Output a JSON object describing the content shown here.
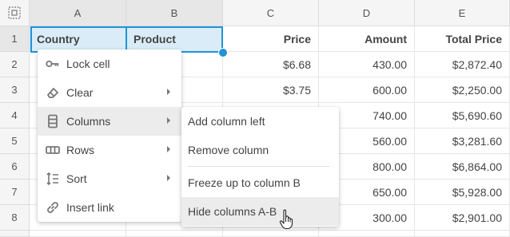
{
  "sheet": {
    "columns": [
      "A",
      "B",
      "C",
      "D",
      "E"
    ],
    "rows": [
      "1",
      "2",
      "3",
      "4",
      "5",
      "6",
      "7",
      "8"
    ],
    "header_row": [
      "Country",
      "Product",
      "Price",
      "Amount",
      "Total Price"
    ],
    "data": [
      [
        "",
        "",
        "$6.68",
        "430.00",
        "$2,872.40"
      ],
      [
        "",
        "",
        "$3.75",
        "600.00",
        "$2,250.00"
      ],
      [
        "",
        "",
        "",
        "740.00",
        "$5,690.60"
      ],
      [
        "",
        "",
        "",
        "560.00",
        "$3,281.60"
      ],
      [
        "",
        "",
        "",
        "800.00",
        "$6,864.00"
      ],
      [
        "",
        "",
        "",
        "650.00",
        "$5,928.00"
      ],
      [
        "",
        "",
        "",
        "300.00",
        "$2,901.00"
      ]
    ]
  },
  "context_menu": {
    "items": [
      {
        "label": "Lock cell",
        "icon": "key-icon"
      },
      {
        "label": "Clear",
        "icon": "eraser-icon"
      },
      {
        "label": "Columns",
        "icon": "columns-icon"
      },
      {
        "label": "Rows",
        "icon": "rows-icon"
      },
      {
        "label": "Sort",
        "icon": "sort-icon"
      },
      {
        "label": "Insert link",
        "icon": "link-icon"
      }
    ]
  },
  "submenu": {
    "items": [
      {
        "label": "Add column left"
      },
      {
        "label": "Remove column"
      },
      {
        "label": "Freeze up to column B"
      },
      {
        "label": "Hide columns A-B"
      }
    ]
  },
  "colors": {
    "selection": "#2193d6",
    "selected_cell_bg": "#d9ecf8",
    "header_bg": "#f5f5f5",
    "menu_hover": "#ececec"
  }
}
